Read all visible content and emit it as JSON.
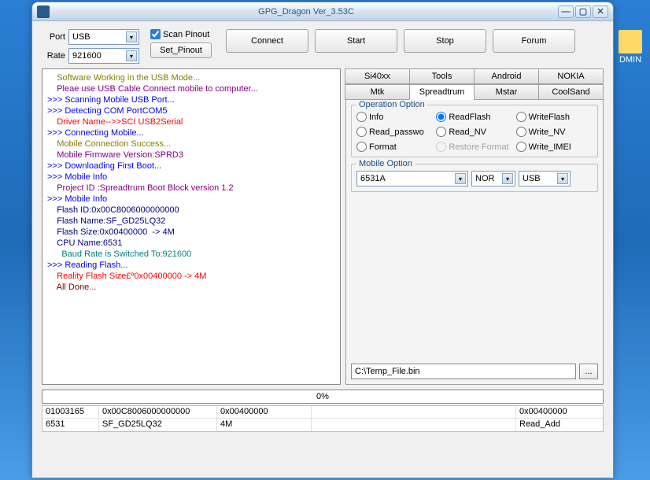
{
  "desktop": {
    "dmin_label": "DMIN"
  },
  "window": {
    "title": "GPG_Dragon  Ver_3.53C"
  },
  "portrate": {
    "port_label": "Port",
    "port_value": "USB",
    "rate_label": "Rate",
    "rate_value": "921600"
  },
  "scan": {
    "checkbox_label": "Scan Pinout",
    "set_btn": "Set_Pinout"
  },
  "main_buttons": {
    "connect": "Connect",
    "start": "Start",
    "stop": "Stop",
    "forum": "Forum"
  },
  "tabs": {
    "row1": [
      "Si40xx",
      "Tools",
      "Android",
      "NOKIA"
    ],
    "row2": [
      "Mtk",
      "Spreadtrum",
      "Mstar",
      "CoolSand"
    ],
    "active": "Spreadtrum"
  },
  "operation": {
    "title": "Operation Option",
    "items": [
      {
        "label": "Info",
        "checked": false
      },
      {
        "label": "ReadFlash",
        "checked": true
      },
      {
        "label": "WriteFlash",
        "checked": false
      },
      {
        "label": "Read_passwo",
        "checked": false
      },
      {
        "label": "Read_NV",
        "checked": false
      },
      {
        "label": "Write_NV",
        "checked": false
      },
      {
        "label": "Format",
        "checked": false
      },
      {
        "label": "Restore Format",
        "checked": false,
        "disabled": true
      },
      {
        "label": "Write_IMEI",
        "checked": false
      }
    ]
  },
  "mobile_option": {
    "title": "Mobile Option",
    "model": "6531A",
    "nor": "NOR",
    "usb": "USB"
  },
  "path": {
    "value": "C:\\Temp_File.bin",
    "browse": "..."
  },
  "progress": {
    "text": "0%"
  },
  "log": [
    {
      "cls": "c-olive",
      "text": "    Software Working in the USB Mode..."
    },
    {
      "cls": "c-purple",
      "text": "    Pleae use USB Cable Connect mobile to computer..."
    },
    {
      "cls": "c-blue",
      "text": ">>> Scanning Mobile USB Port..."
    },
    {
      "cls": "c-blue",
      "text": ">>> Detecting COM PortCOM5"
    },
    {
      "cls": "c-red",
      "text": "    Driver Name-->>SCI USB2Serial"
    },
    {
      "cls": "c-blue",
      "text": ">>> Connecting Mobile..."
    },
    {
      "cls": "c-olive",
      "text": "    Mobile Connection Success..."
    },
    {
      "cls": "c-purple",
      "text": "    Mobile Firmware Version:SPRD3"
    },
    {
      "cls": "c-blue",
      "text": ">>> Downloading First Boot..."
    },
    {
      "cls": "c-blue",
      "text": ">>> Mobile Info"
    },
    {
      "cls": "c-purple",
      "text": "    Project ID :Spreadtrum Boot Block version 1.2"
    },
    {
      "cls": "c-blue",
      "text": ">>> Mobile Info"
    },
    {
      "cls": "c-navy",
      "text": "    Flash ID:0x00C8006000000000"
    },
    {
      "cls": "c-navy",
      "text": "    Flash Name:SF_GD25LQ32"
    },
    {
      "cls": "c-navy",
      "text": "    Flash Size:0x00400000  -> 4M"
    },
    {
      "cls": "c-navy",
      "text": "    CPU Name:6531"
    },
    {
      "cls": "c-teal",
      "text": "      Baud Rate is Switched To:921600"
    },
    {
      "cls": "c-blue",
      "text": ">>> Reading Flash..."
    },
    {
      "cls": "c-red",
      "text": "    Reality Flash Size£º0x00400000 -> 4M"
    },
    {
      "cls": "c-maroon",
      "text": "    All Done..."
    }
  ],
  "info_table": {
    "rows": [
      [
        "01003165",
        "0x00C8006000000000",
        "0x00400000",
        "",
        "0x00400000"
      ],
      [
        "6531",
        "SF_GD25LQ32",
        "4M",
        "",
        "Read_Add"
      ]
    ]
  }
}
